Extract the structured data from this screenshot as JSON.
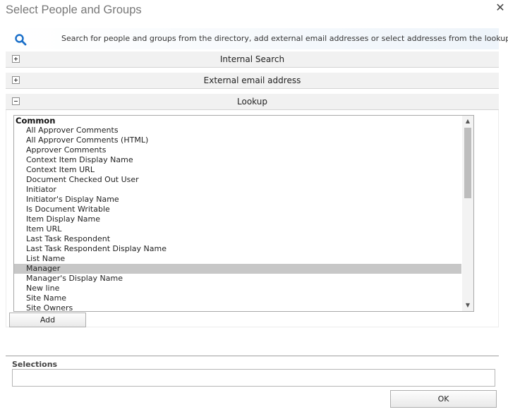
{
  "dialog": {
    "title": "Select People and Groups",
    "close_glyph": "✕"
  },
  "search": {
    "hint": "Search for people and groups from the directory, add external email addresses or select addresses from the lookup list.",
    "icon": "search-icon",
    "icon_color": "#1a6fc9"
  },
  "sections": {
    "internal": {
      "label": "Internal Search",
      "state": "collapsed"
    },
    "external": {
      "label": "External email address",
      "state": "collapsed"
    },
    "lookup": {
      "label": "Lookup",
      "state": "expanded"
    }
  },
  "lookup_list": {
    "group_label": "Common",
    "selected": "Manager",
    "items": [
      "All Approver Comments",
      "All Approver Comments (HTML)",
      "Approver Comments",
      "Context Item Display Name",
      "Context Item URL",
      "Document Checked Out User",
      "Initiator",
      "Initiator's Display Name",
      "Is Document Writable",
      "Item Display Name",
      "Item URL",
      "Last Task Respondent",
      "Last Task Respondent Display Name",
      "List Name",
      "Manager",
      "Manager's Display Name",
      "New line",
      "Site Name",
      "Site Owners"
    ],
    "scroll_up_glyph": "▲",
    "scroll_down_glyph": "▼"
  },
  "buttons": {
    "add": "Add",
    "ok": "OK"
  },
  "selections": {
    "label": "Selections",
    "value": ""
  }
}
